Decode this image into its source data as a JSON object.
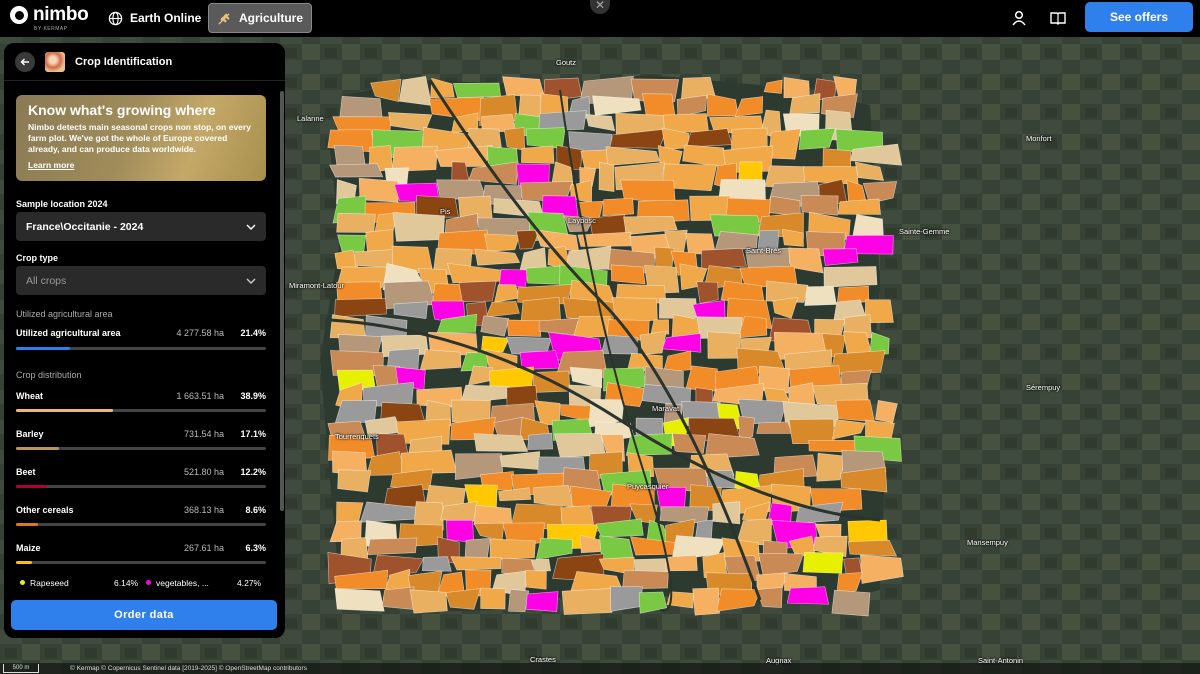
{
  "app": {
    "logo_text": "nimbo",
    "logo_sub": "BY KERMAP"
  },
  "nav": {
    "earth_label": "Earth Online",
    "agri_label": "Agriculture",
    "close_glyph": "✕",
    "see_offers": "See offers"
  },
  "panel": {
    "title": "Crop Identification",
    "banner_title": "Know what's growing where",
    "banner_text": "Nimbo detects main seasonal crops non stop, on every farm plot. We've got the whole of Europe covered already, and can produce data worldwide.",
    "banner_link": "Learn more",
    "sample_label": "Sample location 2024",
    "sample_value": "France\\Occitanie - 2024",
    "crop_type_label": "Crop type",
    "crop_type_value": "All crops",
    "uaa_section": "Utilized agricultural area",
    "uaa": {
      "name": "Utilized agricultural area",
      "ha": "4 277.58 ha",
      "pct": "21.4%",
      "fraction": 0.214,
      "color": "#2f80ed"
    },
    "distribution_section": "Crop distribution",
    "crops": [
      {
        "name": "Wheat",
        "ha": "1 663.51 ha",
        "pct": "38.9%",
        "fraction": 0.389,
        "color": "#e8b97a"
      },
      {
        "name": "Barley",
        "ha": "731.54 ha",
        "pct": "17.1%",
        "fraction": 0.171,
        "color": "#b89468"
      },
      {
        "name": "Beet",
        "ha": "521.80 ha",
        "pct": "12.2%",
        "fraction": 0.122,
        "color": "#b0003a"
      },
      {
        "name": "Other cereals",
        "ha": "368.13 ha",
        "pct": "8.6%",
        "fraction": 0.086,
        "color": "#d87a1a"
      },
      {
        "name": "Maize",
        "ha": "267.61 ha",
        "pct": "6.3%",
        "fraction": 0.063,
        "color": "#f5c400"
      }
    ],
    "mini": [
      {
        "name": "Rapeseed",
        "pct": "6.14%",
        "color": "#e6f000"
      },
      {
        "name": "vegetables, ...",
        "pct": "4.27%",
        "color": "#ff00e6"
      }
    ],
    "order_button": "Order data"
  },
  "map": {
    "places": [
      "Goutz",
      "Lalanne",
      "Monfort",
      "Laybosc",
      "Saint-Brès",
      "Sainte-Gemme",
      "Miramont-Latour",
      "Pis",
      "Sérempuy",
      "Maravat",
      "Tourrenquets",
      "Puycasquier",
      "Mansempuy",
      "Crastes",
      "Augnax",
      "Saint-Antonin"
    ],
    "field_colors": [
      "#f0a848",
      "#e8b060",
      "#f28c28",
      "#f5b062",
      "#d88a2a",
      "#c98a55",
      "#b5977a",
      "#9a9a9a",
      "#7ac943",
      "#ff00e6",
      "#e6f000",
      "#ffc800",
      "#a0522d",
      "#8b4513",
      "#efe0c0",
      "#e0c89a"
    ],
    "scale": "500 m",
    "credits": "© Kermap © Copernicus Sentinel data [2019-2025] © OpenStreetMap contributors"
  }
}
